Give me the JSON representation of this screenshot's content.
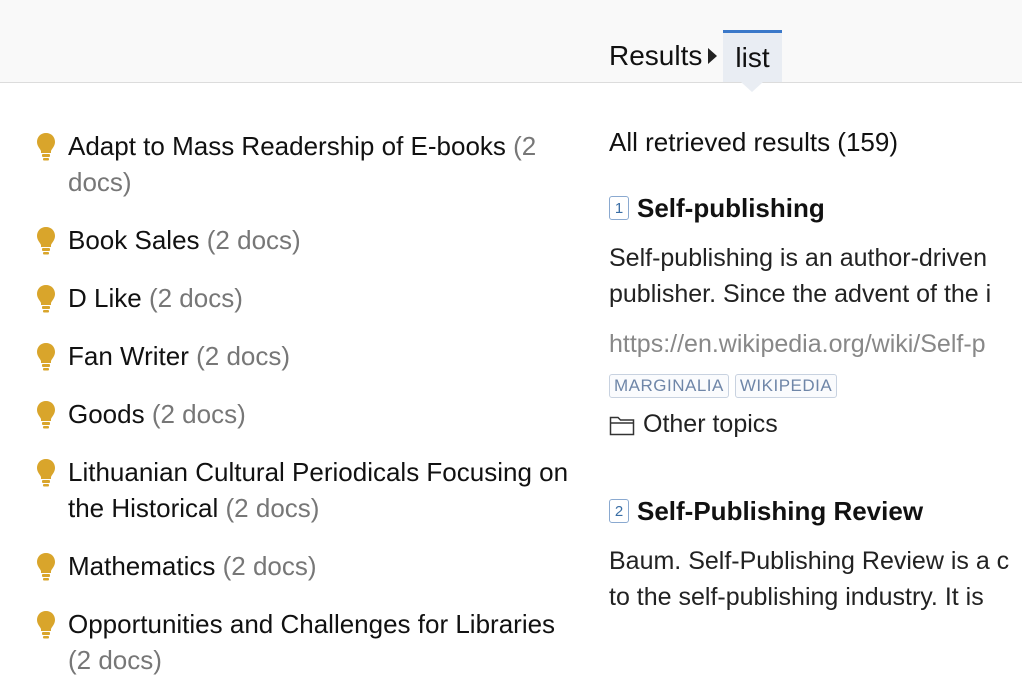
{
  "breadcrumb": {
    "root_label": "Results",
    "active_label": "list"
  },
  "topics": [
    {
      "label": "Adapt to Mass Readership of E-books",
      "count": "(2 docs)"
    },
    {
      "label": "Book Sales",
      "count": "(2 docs)"
    },
    {
      "label": "D Like",
      "count": "(2 docs)"
    },
    {
      "label": "Fan Writer",
      "count": "(2 docs)"
    },
    {
      "label": "Goods",
      "count": "(2 docs)"
    },
    {
      "label": "Lithuanian Cultural Periodicals Focusing on the Historical",
      "count": "(2 docs)"
    },
    {
      "label": "Mathematics",
      "count": "(2 docs)"
    },
    {
      "label": "Opportunities and Challenges for Libraries",
      "count": "(2 docs)"
    }
  ],
  "results": {
    "heading": "All retrieved results (159)",
    "items": [
      {
        "rank": "1",
        "title": "Self-publishing",
        "snippet_line1": "Self-publishing is an author-driven",
        "snippet_line2": "publisher. Since the advent of the i",
        "url": "https://en.wikipedia.org/wiki/Self-p",
        "tags": [
          "MARGINALIA",
          "WIKIPEDIA"
        ],
        "other_topics_label": "Other topics"
      },
      {
        "rank": "2",
        "title": "Self-Publishing Review",
        "snippet_line1": "Baum. Self-Publishing Review is a c",
        "snippet_line2": "to the self-publishing industry. It is"
      }
    ]
  },
  "colors": {
    "accent": "#3a78c9",
    "bulb": "#d9a52b"
  },
  "icons": {
    "topic": "lightbulb-icon",
    "folder": "folder-icon",
    "breadcrumb_separator": "caret-right-icon"
  }
}
